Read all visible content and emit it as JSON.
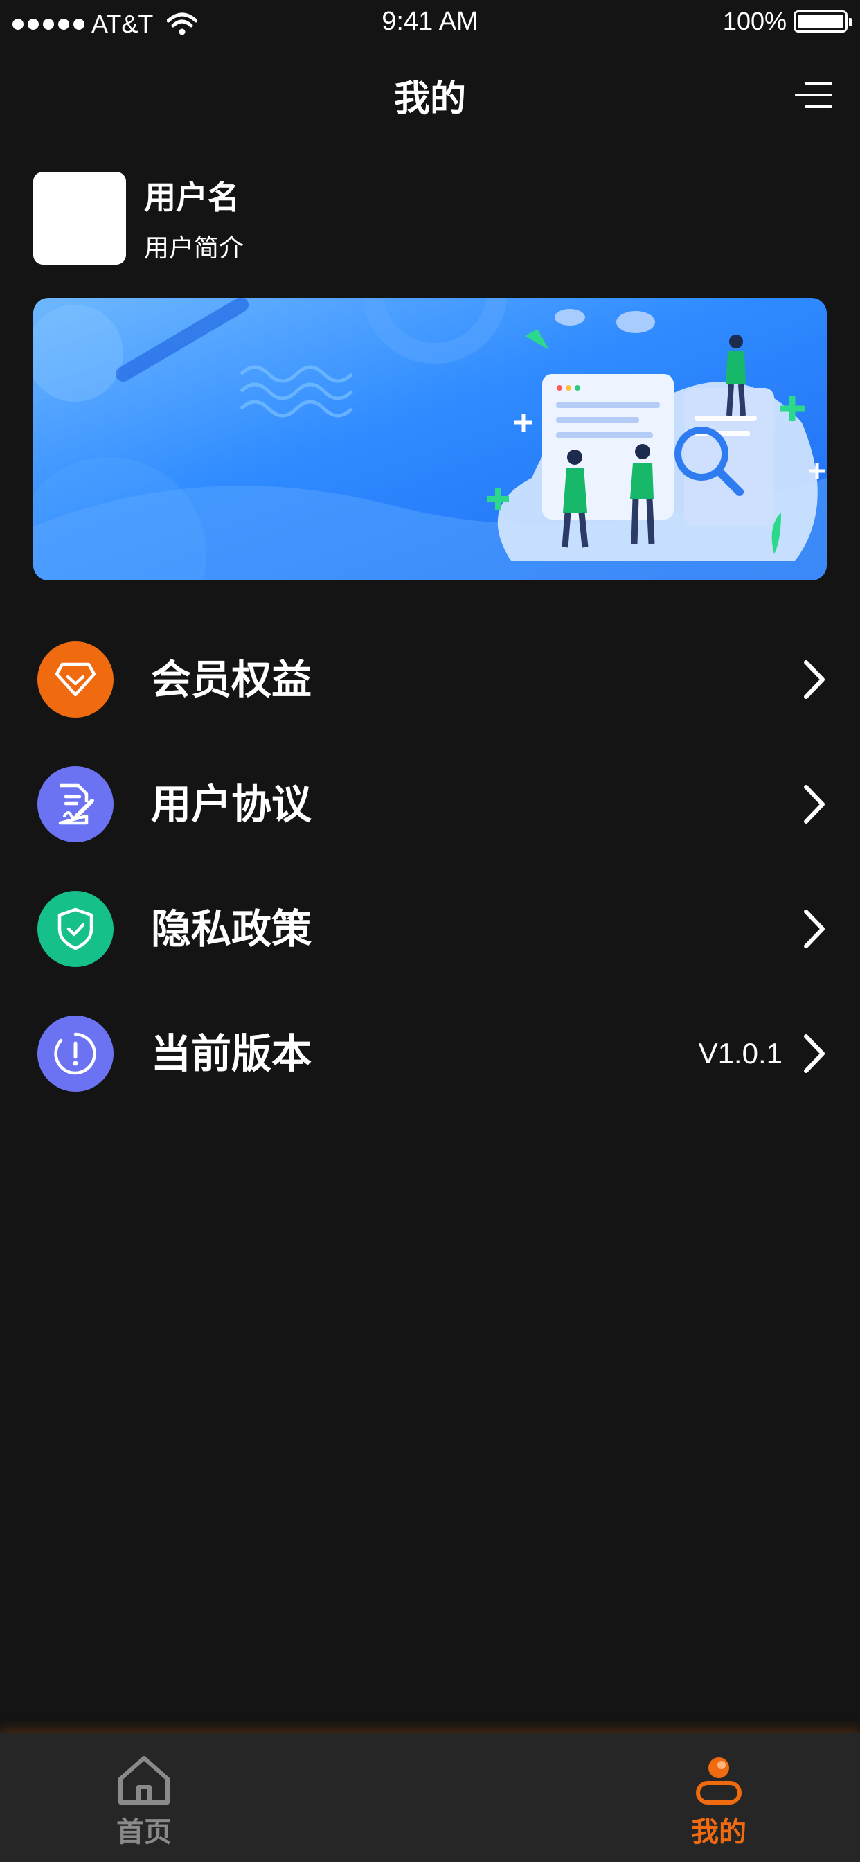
{
  "status_bar": {
    "carrier": "AT&T",
    "time": "9:41 AM",
    "battery": "100%"
  },
  "nav": {
    "title": "我的"
  },
  "profile": {
    "username": "用户名",
    "bio": "用户简介"
  },
  "menu": [
    {
      "label": "会员权益",
      "icon": "diamond-icon",
      "color": "#F06A10",
      "value": ""
    },
    {
      "label": "用户协议",
      "icon": "document-sign-icon",
      "color": "#6B73F2",
      "value": ""
    },
    {
      "label": "隐私政策",
      "icon": "shield-check-icon",
      "color": "#15C08A",
      "value": ""
    },
    {
      "label": "当前版本",
      "icon": "info-icon",
      "color": "#6B73F2",
      "value": "V1.0.1"
    }
  ],
  "tabs": [
    {
      "label": "首页",
      "icon": "home-icon",
      "color": "#8A8A8A",
      "active": false
    },
    {
      "label": "我的",
      "icon": "profile-icon",
      "color": "#F06A10",
      "active": true
    }
  ],
  "colors": {
    "background": "#141414",
    "tabbar": "#262626",
    "accent": "#F06A10"
  }
}
